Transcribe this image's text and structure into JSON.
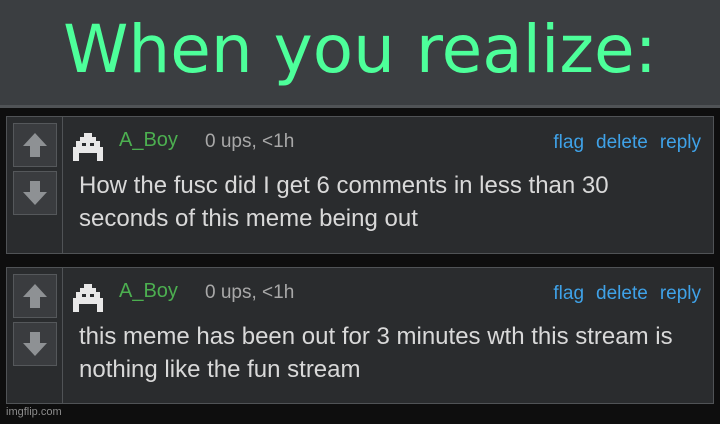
{
  "caption": "When you realize:",
  "comments": [
    {
      "username": "A_Boy",
      "meta": "0 ups, <1h",
      "actions": {
        "flag": "flag",
        "delete": "delete",
        "reply": "reply"
      },
      "text": "How the fusc did I get 6 comments in less than 30 seconds of this meme being out"
    },
    {
      "username": "A_Boy",
      "meta": "0 ups, <1h",
      "actions": {
        "flag": "flag",
        "delete": "delete",
        "reply": "reply"
      },
      "text": "this meme has been out for 3 minutes wth this stream is nothing like the fun stream"
    }
  ],
  "icons": {
    "upvote": "arrow-up-icon",
    "downvote": "arrow-down-icon",
    "avatar": "pixel-avatar-icon"
  },
  "colors": {
    "caption": "#4dff9a",
    "username": "#4caf50",
    "link": "#3fa2e8",
    "meta": "#a8a8a8",
    "text": "#d9d9d9"
  },
  "watermark": "imgflip.com"
}
